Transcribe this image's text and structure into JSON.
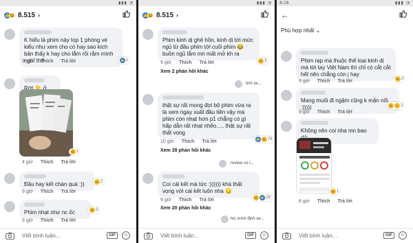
{
  "panel1": {
    "reaction_count": "8.515",
    "comments": [
      {
        "text": "K hiểu là phim này top 1 phòng vé kiểu như xem cho có hay sao kích bản thấy k hay cho lắm rồi rằm mình nghĩ thế",
        "time": "9 giờ",
        "like": "Thích",
        "reply": "Trả lời",
        "reactions": "1"
      },
      {
        "text": "Rớt 👇 ở rạp 😂",
        "time": "4 giờ",
        "like": "Thích",
        "reply": "Trả lời",
        "reactions": "1"
      },
      {
        "text": "Đầu hay kết chán quá :))",
        "time": "9 giờ",
        "like": "Thích",
        "reply": "Trả lời",
        "reactions": "2"
      },
      {
        "text": "Phim nhạt như nc ốc",
        "time": "9 giờ",
        "like": "Thích",
        "reply": "Trả lời",
        "reactions": "3"
      }
    ],
    "composer_placeholder": "Viết bình luận..."
  },
  "panel2": {
    "reaction_count": "8.515",
    "comments": [
      {
        "text": "Phim kinh dị ghê hồn, kinh dị tới mức ngủ từ đầu phim tới cuối phim 😂buồn ngủ lắm mn mất mở kh ra",
        "time": "9 giờ",
        "like": "Thích",
        "reply": "Trả lời",
        "reactions": "3",
        "more": "Xem 2 phản hồi khác",
        "trunc": "tinh xe..."
      },
      {
        "text": "thật sự rất mong đợi bộ phim vừa ra là xem ngay xuất đầu tiên vậy mà phim còn nhạt hơn p1 chẳng có gì hấp dẫn rất nhạt nhẽo..... thật sự rất thất vọng",
        "time": "10 giờ",
        "like": "Thích",
        "reply": "Trả lời",
        "reactions": "76",
        "more": "Xem 39 phản hồi khác",
        "trunc": "review có t..."
      },
      {
        "text": "Coi cái kết mà tức :)))))) khá thất vọng với cái kết luôn nha 😞",
        "time": "9 giờ",
        "like": "Thích",
        "reply": "Trả lời",
        "reactions": "29",
        "more": "Xem 20 phản hồi khác",
        "trunc": "hic mình định xe..."
      }
    ],
    "composer_placeholder": "Viết bình luận..."
  },
  "panel3": {
    "status_time": "8:18",
    "sort_label": "Phù hợp nhất",
    "comments": [
      {
        "text": "Phim rạp mà thuộc thể loại kinh dị mà tới tay Việt Nam thì chỉ có cắt cắt hết nên chẳng còn j hay",
        "time": "9 giờ",
        "like": "Thích",
        "reply": "Trả lời",
        "reactions": "3"
      },
      {
        "text": "Mang muối đi ngậm cũng k mặn nổi :)))))",
        "time": "9 giờ",
        "like": "Thích",
        "reply": "Trả lời",
        "reactions": "3"
      },
      {
        "text": "Không nên coi nha mn bao dở",
        "time": "8 giờ",
        "like": "Thích",
        "reply": "Trả lời",
        "reactions": "1"
      }
    ],
    "composer_placeholder": "Viết bình luận..."
  }
}
